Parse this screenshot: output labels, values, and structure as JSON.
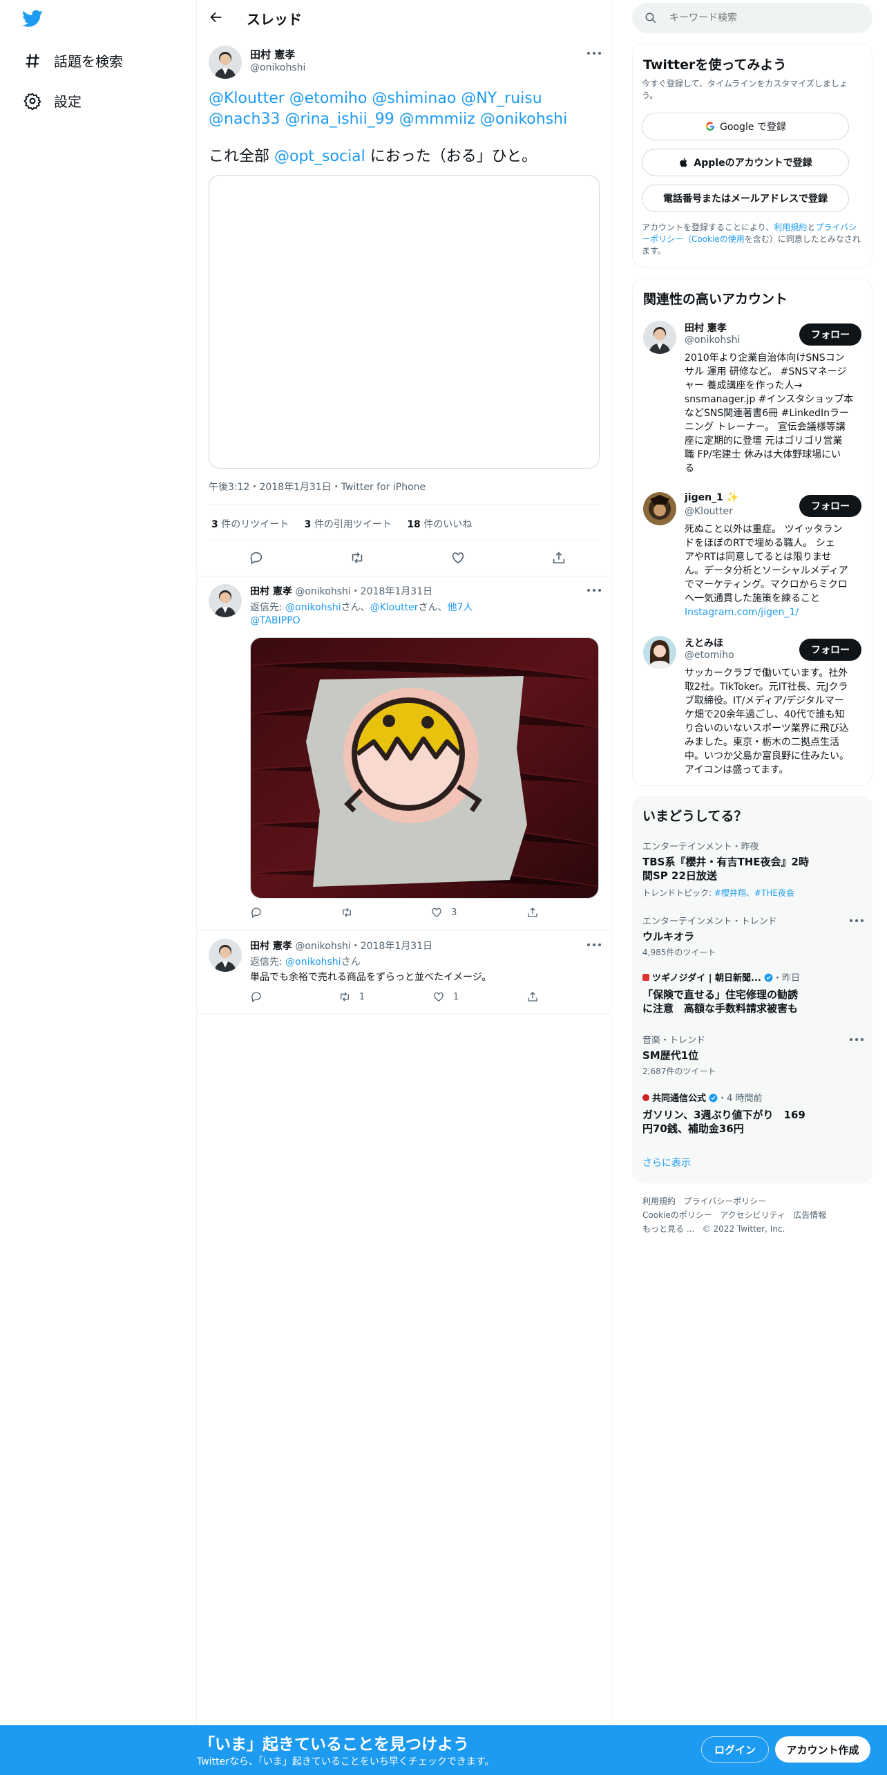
{
  "nav": {
    "explore_label": "話題を検索",
    "settings_label": "設定"
  },
  "header": {
    "title": "スレッド"
  },
  "main_tweet": {
    "author_name": "田村 憲孝",
    "author_handle": "@onikohshi",
    "mentions_line1": "@Kloutter @etomiho @shiminao @NY_ruisu",
    "mentions_line2": "@nach33 @rina_ishii_99 @mmmiiz @onikohshi",
    "text_prefix": "これ全部 ",
    "text_link": "@opt_social",
    "text_suffix": " におった（おる」ひと。",
    "timestamp": "午後3:12・2018年1月31日・Twitter for iPhone",
    "retweets_count": "3",
    "retweets_label": " 件のリツイート",
    "quotes_count": "3",
    "quotes_label": " 件の引用ツイート",
    "likes_count": "18",
    "likes_label": " 件のいいね"
  },
  "reply1": {
    "author_name": "田村 憲孝",
    "meta": "@onikohshi・2018年1月31日",
    "reply_prefix": "返信先: ",
    "reply_to1": "@onikohshi",
    "reply_sep1": "さん、",
    "reply_to2": "@Kloutter",
    "reply_sep2": "さん、",
    "reply_others": "他7人",
    "reply_line2": "@TABIPPO",
    "likes": "3"
  },
  "reply2": {
    "author_name": "田村 憲孝",
    "meta": "@onikohshi・2018年1月31日",
    "reply_prefix": "返信先: ",
    "reply_to": "@onikohshi",
    "reply_suffix": "さん",
    "text": "単品でも余裕で売れる商品をずらっと並べたイメージ。",
    "retweets": "1",
    "likes": "1"
  },
  "search": {
    "placeholder": "キーワード検索"
  },
  "signup": {
    "title": "Twitterを使ってみよう",
    "subtitle": "今すぐ登録して、タイムラインをカスタマイズしましょう。",
    "google_label": "Google で登録",
    "apple_label": "Appleのアカウントで登録",
    "phone_label": "電話番号またはメールアドレスで登録",
    "terms_prefix": "アカウントを登録することにより、",
    "terms_link1": "利用規約",
    "terms_and": "と",
    "terms_link2": "プライバシーポリシー（Cookieの使用",
    "terms_suffix": "を含む）に同意したとみなされます。"
  },
  "related": {
    "title": "関連性の高いアカウント",
    "follow_label": "フォロー",
    "accounts": [
      {
        "name": "田村 憲孝",
        "handle": "@onikohshi",
        "bio_lines": [
          "2010年より企業自治体向けSNSコン",
          "サル 運用 研修など。 #SNSマネージ",
          "ャー 養成講座を作った人→",
          "snsmanager.jp #インスタショップ本",
          "などSNS関連著書6冊 #LinkedInラー",
          "ニング トレーナー。 宣伝会議様等講",
          "座に定期的に登壇 元はゴリゴリ営業",
          "職 FP/宅建士 休みは大体野球場にい",
          "る"
        ]
      },
      {
        "name": "jigen_1 ✨",
        "handle": "@Kloutter",
        "bio_lines": [
          "死ぬこと以外は重症。 ツイッタラン",
          "ドをほぼのRTで埋める職人。 シェ",
          "アやRTは同意してるとは限りませ",
          "ん。データ分析とソーシャルメディア",
          "でマーケティング。マクロからミクロ",
          "へ一気通貫した施策を練ること",
          "Instagram.com/jigen_1/"
        ]
      },
      {
        "name": "えとみほ",
        "handle": "@etomiho",
        "bio_lines": [
          "サッカークラブで働いています。社外",
          "取2社。TikToker。元IT社長、元Jクラ",
          "ブ取締役。IT/メディア/デジタルマー",
          "ケ畑で20余年過ごし、40代で誰も知",
          "り合いのいないスポーツ業界に飛び込",
          "みました。東京・栃木の二拠点生活",
          "中。いつか父島か富良野に住みたい。",
          "アイコンは盛ってます。"
        ]
      }
    ]
  },
  "trends": {
    "title": "いまどうしてる？",
    "items": [
      {
        "meta": "エンターテインメント・昨夜",
        "title1": "TBS系『櫻井・有吉THE夜会』2時",
        "title2": "間SP 22日放送",
        "extra_prefix": "トレンドトピック: ",
        "extra": "#櫻井翔、#THE夜会"
      },
      {
        "meta": "エンターテインメント・トレンド",
        "title1": "ウルキオラ",
        "count": "4,985件のツイート"
      },
      {
        "source": "ツギノジダイ | 朝日新聞...",
        "time": "・昨日",
        "title1": "「保険で直せる」住宅修理の勧誘",
        "title2": "に注意　高額な手数料請求被害も"
      },
      {
        "meta": "音楽・トレンド",
        "title1": "SM歴代1位",
        "count": "2,687件のツイート"
      },
      {
        "source": "共同通信公式",
        "time": "・4 時間前",
        "title1": "ガソリン、3週ぶり値下がり　169",
        "title2": "円70銭、補助金36円"
      }
    ],
    "show_more": "さらに表示"
  },
  "footer": {
    "terms": "利用規約",
    "privacy": "プライバシーポリシー",
    "cookies": "Cookieのポリシー",
    "accessibility": "アクセシビリティ",
    "ads": "広告情報",
    "more": "もっと見る ...",
    "copyright": "© 2022 Twitter, Inc."
  },
  "banner": {
    "headline": "「いま」起きていることを見つけよう",
    "subtext": "Twitterなら、「いま」起きていることをいち早くチェックできます。",
    "login_label": "ログイン",
    "signup_label": "アカウント作成"
  },
  "colors": {
    "accent": "#1d9bf0",
    "text": "#0f1419",
    "muted": "#536471",
    "border": "#eff3f4"
  }
}
